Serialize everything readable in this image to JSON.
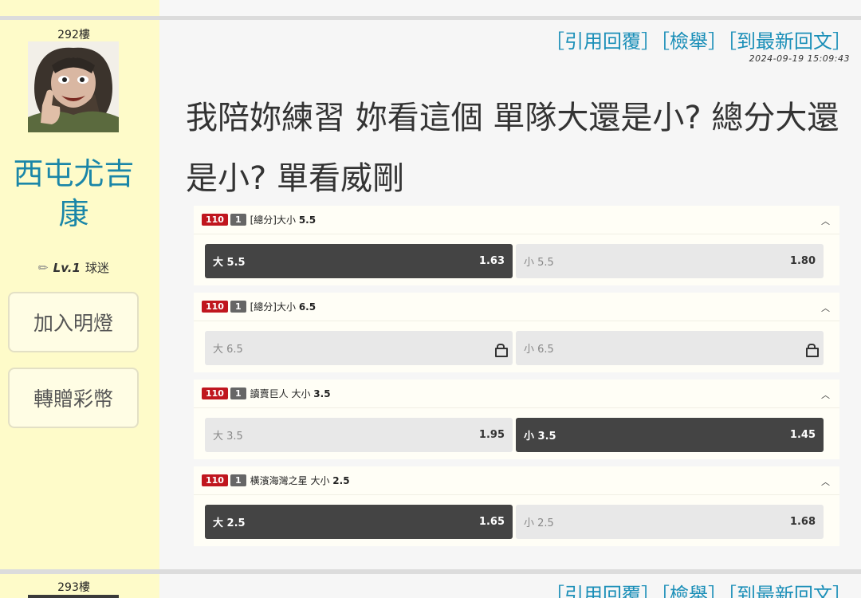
{
  "posts": [
    {
      "floor": "292樓",
      "username": "西屯尤吉康",
      "level": "Lv.1",
      "level_title": "球迷",
      "buttons": {
        "favorite": "加入明燈",
        "gift": "轉贈彩幣"
      },
      "actions": {
        "quote": "［引用回覆］",
        "report": "［檢舉］",
        "latest": "［到最新回文］"
      },
      "timestamp": "2024-09-19 15:09:43",
      "text": "我陪妳練習 妳看這個 單隊大還是小? 總分大還是小? 單看威剛",
      "markets": [
        {
          "badge_code": "110",
          "badge_num": "1",
          "title": "[總分]大小",
          "line": "5.5",
          "options": [
            {
              "label": "大 5.5",
              "odds": "1.63",
              "selected": true,
              "locked": false
            },
            {
              "label": "小 5.5",
              "odds": "1.80",
              "selected": false,
              "locked": false
            }
          ]
        },
        {
          "badge_code": "110",
          "badge_num": "1",
          "title": "[總分]大小",
          "line": "6.5",
          "options": [
            {
              "label": "大 6.5",
              "odds": "",
              "selected": false,
              "locked": true
            },
            {
              "label": "小 6.5",
              "odds": "",
              "selected": false,
              "locked": true
            }
          ]
        },
        {
          "badge_code": "110",
          "badge_num": "1",
          "title": "讀賣巨人 大小",
          "line": "3.5",
          "options": [
            {
              "label": "大 3.5",
              "odds": "1.95",
              "selected": false,
              "locked": false
            },
            {
              "label": "小 3.5",
              "odds": "1.45",
              "selected": true,
              "locked": false
            }
          ]
        },
        {
          "badge_code": "110",
          "badge_num": "1",
          "title": "橫濱海灣之星 大小",
          "line": "2.5",
          "options": [
            {
              "label": "大 2.5",
              "odds": "1.65",
              "selected": true,
              "locked": false
            },
            {
              "label": "小 2.5",
              "odds": "1.68",
              "selected": false,
              "locked": false
            }
          ]
        }
      ]
    },
    {
      "floor": "293樓",
      "actions": {
        "quote": "［引用回覆］",
        "report": "［檢舉］",
        "latest": "［到最新回文］"
      }
    }
  ],
  "colors": {
    "sidebar": "#fefbc9",
    "username": "#1a86a8",
    "link": "#1b8fb8",
    "badge_red": "#c0161e",
    "selected": "#444444"
  }
}
